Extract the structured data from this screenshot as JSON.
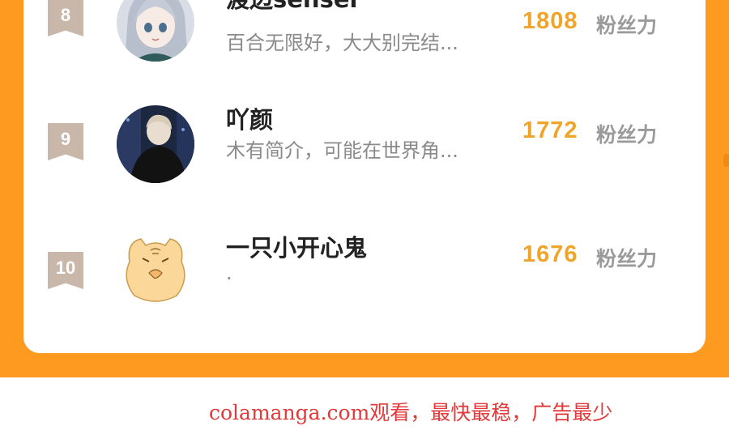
{
  "ranking": {
    "score_unit": "粉丝力",
    "entries": [
      {
        "rank": "8",
        "name": "渡边sensei",
        "bio": "百合无限好，大大别完结...",
        "score": "1808",
        "avatar": "anime-girl-avatar"
      },
      {
        "rank": "9",
        "name": "吖颜",
        "bio": "木有简介，可能在世界角...",
        "score": "1772",
        "avatar": "person-photo-avatar"
      },
      {
        "rank": "10",
        "name": "一只小开心鬼",
        "bio": ".",
        "score": "1676",
        "avatar": "cat-drawing-avatar"
      }
    ]
  },
  "watermark": {
    "text": "colamanga.com观看，最快最稳，广告最少"
  },
  "colors": {
    "frame": "#fd9a1f",
    "score": "#f1a42a",
    "badge": "#c9b8aa",
    "watermark": "#e23a3a"
  }
}
